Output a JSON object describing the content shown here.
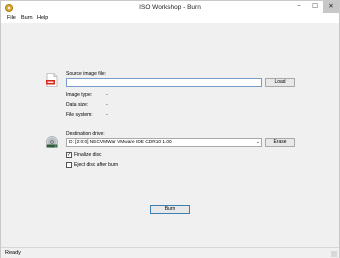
{
  "window": {
    "title": "ISO Workshop - Burn",
    "controls": {
      "minimize": "−",
      "maximize": "☐",
      "close": "✕"
    }
  },
  "menu": {
    "items": [
      "File",
      "Burn",
      "Help"
    ]
  },
  "source": {
    "label": "Source image file:",
    "value": "",
    "load_button": "Load",
    "icon": "iso-file-icon"
  },
  "info": {
    "image_type_label": "Image type:",
    "image_type_value": "-",
    "data_size_label": "Data size:",
    "data_size_value": "-",
    "file_system_label": "File system:",
    "file_system_value": "-"
  },
  "destination": {
    "label": "Destination drive:",
    "selected": "D:  [2:0:0] NECVMWar VMware IDE CDR10 1.00",
    "erase_button": "Erase",
    "icon": "disc-drive-icon"
  },
  "options": {
    "finalize_label": "Finalize disc",
    "finalize_checked": true,
    "eject_label": "Eject disc after burn",
    "eject_checked": false
  },
  "actions": {
    "burn_button": "Burn"
  },
  "status": {
    "text": "Ready"
  },
  "colors": {
    "accent": "#3c7fb1",
    "window_bg": "#f0f0f0",
    "close_hover": "#c7c7c7"
  }
}
